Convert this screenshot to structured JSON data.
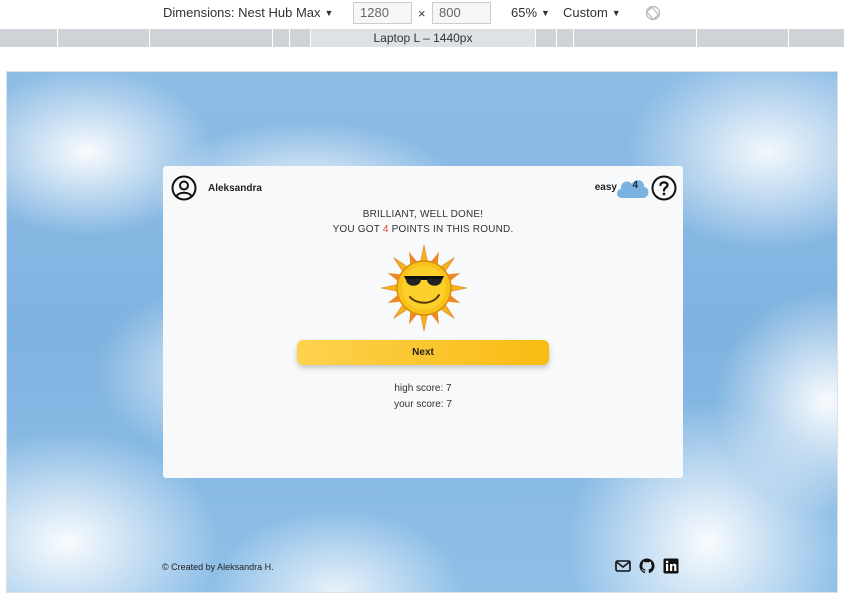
{
  "devtools": {
    "dimensions_label": "Dimensions: Nest Hub Max",
    "width": "1280",
    "height": "800",
    "times": "×",
    "zoom": "65%",
    "throttle": "Custom",
    "media_query_label": "Laptop L – 1440px"
  },
  "header": {
    "username": "Aleksandra",
    "level": "easy",
    "round_number": "4"
  },
  "result": {
    "line1": "BRILLIANT, WELL DONE!",
    "line2_prefix": "YOU GOT ",
    "points": "4",
    "line2_suffix": " POINTS IN THIS ROUND."
  },
  "next_button": "Next",
  "scores": {
    "high": "high score: 7",
    "yours": "your score: 7"
  },
  "footer": {
    "credit": "© Created by Aleksandra H."
  },
  "colors": {
    "accent": "#f8bb12",
    "points": "#e04b33",
    "cloud": "#7ab3e0"
  }
}
